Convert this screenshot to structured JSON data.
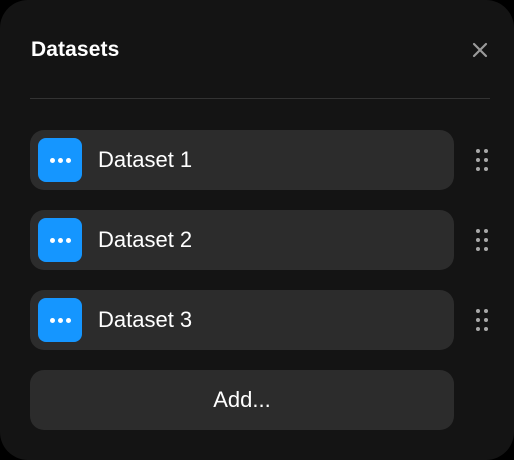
{
  "panel": {
    "title": "Datasets",
    "close_icon": "close-icon"
  },
  "datasets": [
    {
      "label": "Dataset 1",
      "menu_icon": "more-horizontal-icon",
      "drag_icon": "drag-handle-icon"
    },
    {
      "label": "Dataset 2",
      "menu_icon": "more-horizontal-icon",
      "drag_icon": "drag-handle-icon"
    },
    {
      "label": "Dataset 3",
      "menu_icon": "more-horizontal-icon",
      "drag_icon": "drag-handle-icon"
    }
  ],
  "add_button": {
    "label": "Add..."
  },
  "colors": {
    "panel_background": "#141414",
    "row_background": "#2c2c2c",
    "accent": "#1596ff",
    "divider": "#333333",
    "close_icon": "#9a9a9a",
    "drag_handle": "#a8a8a8"
  }
}
